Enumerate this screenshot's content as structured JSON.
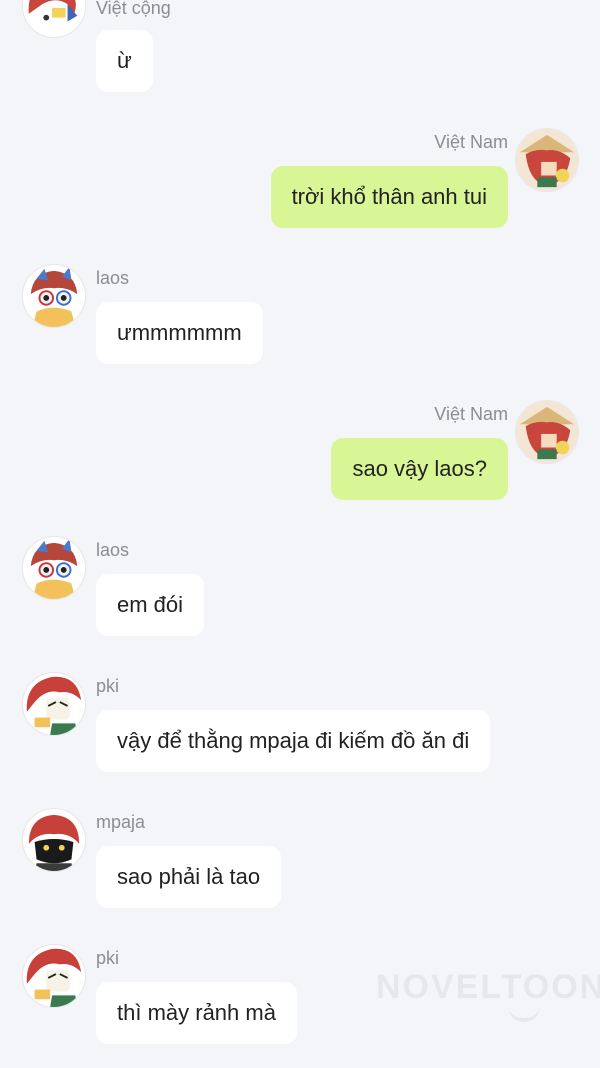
{
  "messages": [
    {
      "sender": "Việt cộng",
      "text": "ừ",
      "side": "in",
      "avatar_icon": "viet-cong-avatar-icon"
    },
    {
      "sender": "Việt Nam",
      "text": "trời khổ thân anh tui",
      "side": "out",
      "avatar_icon": "viet-nam-avatar-icon"
    },
    {
      "sender": "laos",
      "text": "ưmmmmmm",
      "side": "in",
      "avatar_icon": "laos-avatar-icon"
    },
    {
      "sender": "Việt Nam",
      "text": "sao vậy laos?",
      "side": "out",
      "avatar_icon": "viet-nam-avatar-icon"
    },
    {
      "sender": "laos",
      "text": "em đói",
      "side": "in",
      "avatar_icon": "laos-avatar-icon"
    },
    {
      "sender": "pki",
      "text": "vậy để thằng mpaja đi kiếm đồ ăn đi",
      "side": "in",
      "avatar_icon": "pki-avatar-icon"
    },
    {
      "sender": "mpaja",
      "text": "sao phải là tao",
      "side": "in",
      "avatar_icon": "mpaja-avatar-icon"
    },
    {
      "sender": "pki",
      "text": "thì mày rảnh mà",
      "side": "in",
      "avatar_icon": "pki-avatar-icon"
    }
  ],
  "watermark": "NOVELTOON",
  "colors": {
    "background": "#f4f5f9",
    "incoming_bubble": "#ffffff",
    "outgoing_bubble": "#d9f696",
    "sender_name": "#8a8d93"
  }
}
